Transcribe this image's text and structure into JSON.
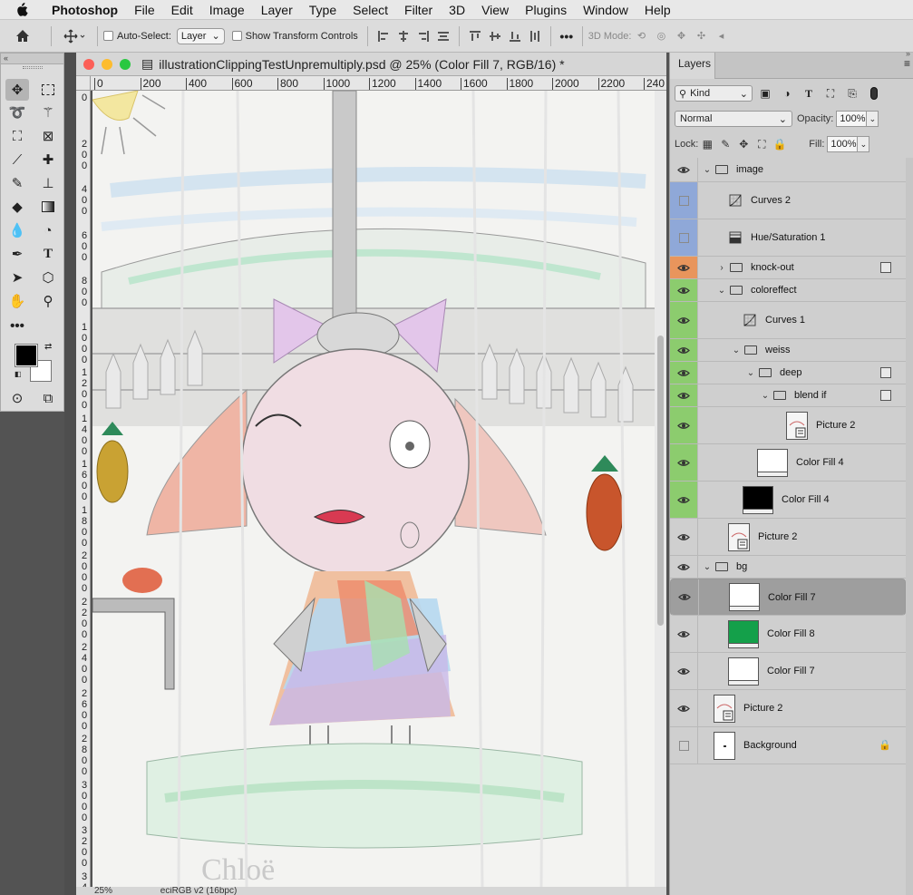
{
  "menubar": {
    "app_name": "Photoshop",
    "items": [
      "File",
      "Edit",
      "Image",
      "Layer",
      "Type",
      "Select",
      "Filter",
      "3D",
      "View",
      "Plugins",
      "Window",
      "Help"
    ]
  },
  "options_bar": {
    "auto_select_label": "Auto-Select:",
    "auto_select_value": "Layer",
    "show_transform_label": "Show Transform Controls",
    "mode_3d_label": "3D Mode:"
  },
  "document": {
    "title": "illustrationClippingTestUnpremultiply.psd @ 25% (Color Fill 7, RGB/16) *",
    "ruler_h": [
      "0",
      "200",
      "400",
      "600",
      "800",
      "1000",
      "1200",
      "1400",
      "1600",
      "1800",
      "2000",
      "2200",
      "240"
    ],
    "ruler_v": [
      "0",
      "2\n0\n0",
      "4\n0\n0",
      "6\n0\n0",
      "8\n0\n0",
      "1\n0\n0\n0",
      "1\n2\n0\n0",
      "1\n4\n0\n0",
      "1\n6\n0\n0",
      "1\n8\n0\n0",
      "2\n0\n0\n0",
      "2\n2\n0\n0",
      "2\n4\n0\n0",
      "2\n6\n0\n0",
      "2\n8\n0\n0",
      "3\n0\n0\n0",
      "3\n2\n0\n0",
      "3\n4\n0"
    ],
    "zoom": "25%",
    "profile": "eciRGB v2 (16bpc)"
  },
  "layers_panel": {
    "tab": "Layers",
    "filter_kind": "Kind",
    "blend_mode": "Normal",
    "opacity_label": "Opacity:",
    "opacity": "100%",
    "lock_label": "Lock:",
    "fill_label": "Fill:",
    "fill": "100%",
    "layers": [
      {
        "name": "image",
        "type": "group",
        "expanded": true,
        "indent": 0,
        "visible": true,
        "color": "none",
        "height": 27
      },
      {
        "name": "Curves 2",
        "type": "curves",
        "indent": 1,
        "visible": false,
        "color": "#8fa8d8",
        "height": 41
      },
      {
        "name": "Hue/Saturation 1",
        "type": "huesat",
        "indent": 1,
        "visible": false,
        "color": "#8fa8d8",
        "height": 41
      },
      {
        "name": "knock-out",
        "type": "group",
        "expanded": false,
        "indent": 1,
        "visible": true,
        "color": "#e8955c",
        "linked": true,
        "height": 25
      },
      {
        "name": "coloreffect",
        "type": "group",
        "expanded": true,
        "indent": 1,
        "visible": true,
        "color": "#8ccc6e",
        "height": 25
      },
      {
        "name": "Curves 1",
        "type": "curves",
        "indent": 2,
        "visible": true,
        "color": "#8ccc6e",
        "height": 41
      },
      {
        "name": "weiss",
        "type": "group",
        "expanded": true,
        "indent": 2,
        "visible": true,
        "color": "#8ccc6e",
        "height": 25
      },
      {
        "name": "deep",
        "type": "group",
        "expanded": true,
        "indent": 3,
        "visible": true,
        "color": "#8ccc6e",
        "linked": true,
        "height": 25
      },
      {
        "name": "blend if",
        "type": "group",
        "expanded": true,
        "indent": 4,
        "visible": true,
        "color": "#8ccc6e",
        "linked": true,
        "height": 25
      },
      {
        "name": "Picture 2",
        "type": "smart",
        "indent": 5,
        "visible": true,
        "color": "#8ccc6e",
        "height": 41
      },
      {
        "name": "Color Fill 4",
        "type": "fill",
        "fill": "#ffffff",
        "indent": 3,
        "visible": true,
        "color": "#8ccc6e",
        "height": 41
      },
      {
        "name": "Color Fill 4",
        "type": "fill",
        "fill": "#000000",
        "indent": 2,
        "visible": true,
        "color": "#8ccc6e",
        "height": 41
      },
      {
        "name": "Picture 2",
        "type": "smart",
        "indent": 1,
        "visible": true,
        "color": "none",
        "height": 41
      },
      {
        "name": "bg",
        "type": "group",
        "expanded": true,
        "indent": 0,
        "visible": true,
        "color": "none",
        "height": 25
      },
      {
        "name": "Color Fill 7",
        "type": "fill",
        "fill": "#ffffff",
        "indent": 1,
        "visible": true,
        "color": "none",
        "selected": true,
        "height": 41
      },
      {
        "name": "Color Fill 8",
        "type": "fill",
        "fill": "#14a04a",
        "indent": 1,
        "visible": true,
        "color": "none",
        "height": 41
      },
      {
        "name": "Color Fill 7",
        "type": "fill",
        "fill": "#ffffff",
        "indent": 1,
        "visible": true,
        "color": "none",
        "height": 41
      },
      {
        "name": "Picture 2",
        "type": "smart",
        "indent": 0,
        "visible": true,
        "color": "none",
        "height": 41
      },
      {
        "name": "Background",
        "type": "background",
        "indent": 0,
        "visible": false,
        "color": "none",
        "locked": true,
        "height": 41
      }
    ]
  }
}
